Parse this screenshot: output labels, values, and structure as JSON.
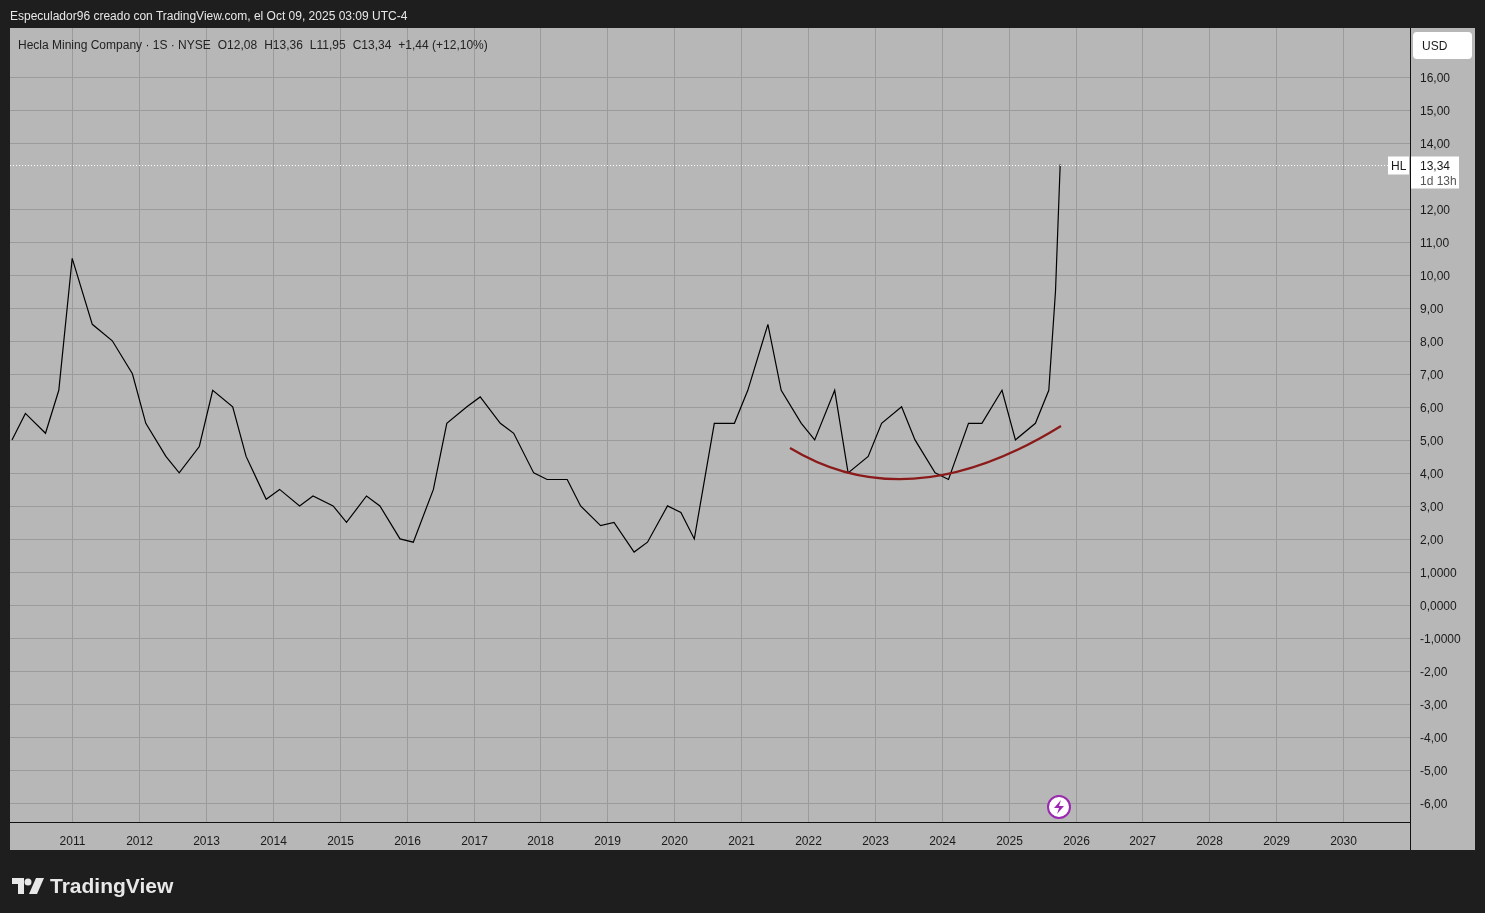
{
  "header": {
    "text": "Especulador96 creado con TradingView.com, el Oct 09, 2025 03:09 UTC-4"
  },
  "legend": {
    "title": "Hecla Mining Company · 1S · NYSE",
    "open": "O12,08",
    "high": "H13,36",
    "low": "L11,95",
    "close": "C13,34",
    "change": "+1,44 (+12,10%)"
  },
  "currency": "USD",
  "last_price": {
    "value": "13,34",
    "countdown": "1d 13h"
  },
  "chart_data": {
    "type": "line",
    "grid": true,
    "xlim": [
      2010.07,
      2031.0
    ],
    "ylim": [
      -6.58,
      17.48
    ],
    "x": [
      2010.1,
      2010.3,
      2010.6,
      2010.8,
      2011.0,
      2011.3,
      2011.6,
      2011.9,
      2012.1,
      2012.4,
      2012.6,
      2012.9,
      2013.1,
      2013.4,
      2013.6,
      2013.9,
      2014.1,
      2014.4,
      2014.6,
      2014.9,
      2015.1,
      2015.4,
      2015.6,
      2015.9,
      2016.1,
      2016.4,
      2016.6,
      2016.9,
      2017.1,
      2017.4,
      2017.6,
      2017.9,
      2018.1,
      2018.4,
      2018.6,
      2018.9,
      2019.1,
      2019.4,
      2019.6,
      2019.9,
      2020.1,
      2020.3,
      2020.6,
      2020.9,
      2021.1,
      2021.4,
      2021.6,
      2021.9,
      2022.1,
      2022.4,
      2022.6,
      2022.9,
      2023.1,
      2023.4,
      2023.6,
      2023.9,
      2024.1,
      2024.4,
      2024.6,
      2024.9,
      2025.1,
      2025.4,
      2025.6,
      2025.7,
      2025.77
    ],
    "series": [
      {
        "name": "HL",
        "color": "#000000",
        "values": [
          5.0,
          5.8,
          5.2,
          6.5,
          10.5,
          8.5,
          8.0,
          7.0,
          5.5,
          4.5,
          4.0,
          4.8,
          6.5,
          6.0,
          4.5,
          3.2,
          3.5,
          3.0,
          3.3,
          3.0,
          2.5,
          3.3,
          3.0,
          2.0,
          1.9,
          3.5,
          5.5,
          6.0,
          6.3,
          5.5,
          5.2,
          4.0,
          3.8,
          3.8,
          3.0,
          2.4,
          2.5,
          1.6,
          1.9,
          3.0,
          2.8,
          2.0,
          5.5,
          5.5,
          6.5,
          8.5,
          6.5,
          5.5,
          5.0,
          6.5,
          4.0,
          4.5,
          5.5,
          6.0,
          5.0,
          4.0,
          3.8,
          5.5,
          5.5,
          6.5,
          5.0,
          5.5,
          6.5,
          9.5,
          13.34
        ]
      }
    ],
    "xticks": [
      {
        "value": 2011,
        "label": "2011"
      },
      {
        "value": 2012,
        "label": "2012"
      },
      {
        "value": 2013,
        "label": "2013"
      },
      {
        "value": 2014,
        "label": "2014"
      },
      {
        "value": 2015,
        "label": "2015"
      },
      {
        "value": 2016,
        "label": "2016"
      },
      {
        "value": 2017,
        "label": "2017"
      },
      {
        "value": 2018,
        "label": "2018"
      },
      {
        "value": 2019,
        "label": "2019"
      },
      {
        "value": 2020,
        "label": "2020"
      },
      {
        "value": 2021,
        "label": "2021"
      },
      {
        "value": 2022,
        "label": "2022"
      },
      {
        "value": 2023,
        "label": "2023"
      },
      {
        "value": 2024,
        "label": "2024"
      },
      {
        "value": 2025,
        "label": "2025"
      },
      {
        "value": 2026,
        "label": "2026"
      },
      {
        "value": 2027,
        "label": "2027"
      },
      {
        "value": 2028,
        "label": "2028"
      },
      {
        "value": 2029,
        "label": "2029"
      },
      {
        "value": 2030,
        "label": "2030"
      }
    ],
    "yticks": [
      {
        "value": 16,
        "label": "16,00"
      },
      {
        "value": 15,
        "label": "15,00"
      },
      {
        "value": 14,
        "label": "14,00"
      },
      {
        "value": 12,
        "label": "12,00"
      },
      {
        "value": 11,
        "label": "11,00"
      },
      {
        "value": 10,
        "label": "10,00"
      },
      {
        "value": 9,
        "label": "9,00"
      },
      {
        "value": 8,
        "label": "8,00"
      },
      {
        "value": 7,
        "label": "7,00"
      },
      {
        "value": 6,
        "label": "6,00"
      },
      {
        "value": 5,
        "label": "5,00"
      },
      {
        "value": 4,
        "label": "4,00"
      },
      {
        "value": 3,
        "label": "3,00"
      },
      {
        "value": 2,
        "label": "2,00"
      },
      {
        "value": 1,
        "label": "1,0000"
      },
      {
        "value": 0,
        "label": "0,0000"
      },
      {
        "value": -1,
        "label": "-1,0000"
      },
      {
        "value": -2,
        "label": "-2,00"
      },
      {
        "value": -3,
        "label": "-3,00"
      },
      {
        "value": -4,
        "label": "-4,00"
      },
      {
        "value": -5,
        "label": "-5,00"
      },
      {
        "value": -6,
        "label": "-6,00"
      }
    ]
  },
  "footer": {
    "brand": "TradingView"
  }
}
